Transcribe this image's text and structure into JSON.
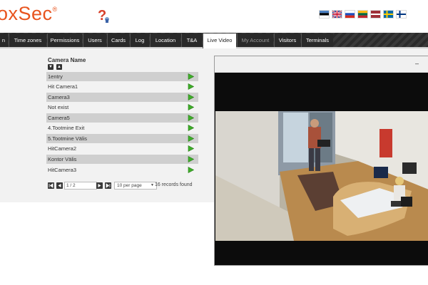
{
  "brand": {
    "logo_text": "oxSec",
    "registered": "®"
  },
  "languages": [
    {
      "name": "estonian-flag",
      "c1": "#4a7fc1",
      "c2": "#000000",
      "c3": "#ffffff"
    },
    {
      "name": "uk-flag"
    },
    {
      "name": "russian-flag",
      "c1": "#ffffff",
      "c2": "#1c4fbf",
      "c3": "#d52b1e"
    },
    {
      "name": "lithuanian-flag",
      "c1": "#fdb913",
      "c2": "#006a44",
      "c3": "#c1272d"
    },
    {
      "name": "latvian-flag"
    },
    {
      "name": "swedish-flag"
    },
    {
      "name": "finnish-flag"
    }
  ],
  "nav": {
    "tabs": [
      "n",
      "Time zones",
      "Permissions",
      "Users",
      "Cards",
      "Log",
      "Location",
      "T&A",
      "Live Video",
      "My Account",
      "Visitors",
      "Terminals"
    ],
    "active": "Live Video"
  },
  "camera_list": {
    "header": "Camera Name",
    "rows": [
      "1entry",
      "Hit Camera1",
      "Camera3",
      "Not exist",
      "Camera5",
      "4.Tootmine Exit",
      "5.Tootmine Välis",
      "HitCamera2",
      "Kontor Välis",
      "HitCamera3"
    ]
  },
  "pager": {
    "page": "1 / 2",
    "per_page": "10 per page",
    "records": "16 records found"
  },
  "video": {
    "minimize": "–"
  },
  "colors": {
    "accent": "#e8541e",
    "play": "#3fae2a",
    "nav_bg": "#2a2a2a"
  }
}
